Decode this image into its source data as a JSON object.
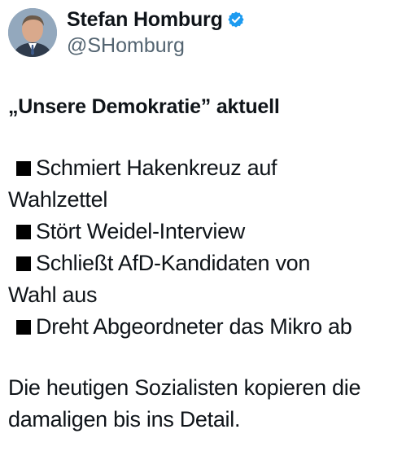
{
  "author": {
    "display_name": "Stefan Homburg",
    "handle": "@SHomburg",
    "verified_icon": "verified-badge-icon",
    "accent_color": "#1d9bf0"
  },
  "tweet": {
    "headline": "„Unsere Demokratie” aktuell",
    "bullets": [
      [
        "Schmiert Hakenkreuz auf",
        "Wahlzettel"
      ],
      [
        "Stört Weidel-Interview"
      ],
      [
        "Schließt AfD-Kandidaten von",
        "Wahl aus"
      ],
      [
        "Dreht Abgeordneter das Mikro ab"
      ]
    ],
    "closing": [
      "Die heutigen Sozialisten kopieren die",
      "damaligen bis ins Detail."
    ]
  }
}
